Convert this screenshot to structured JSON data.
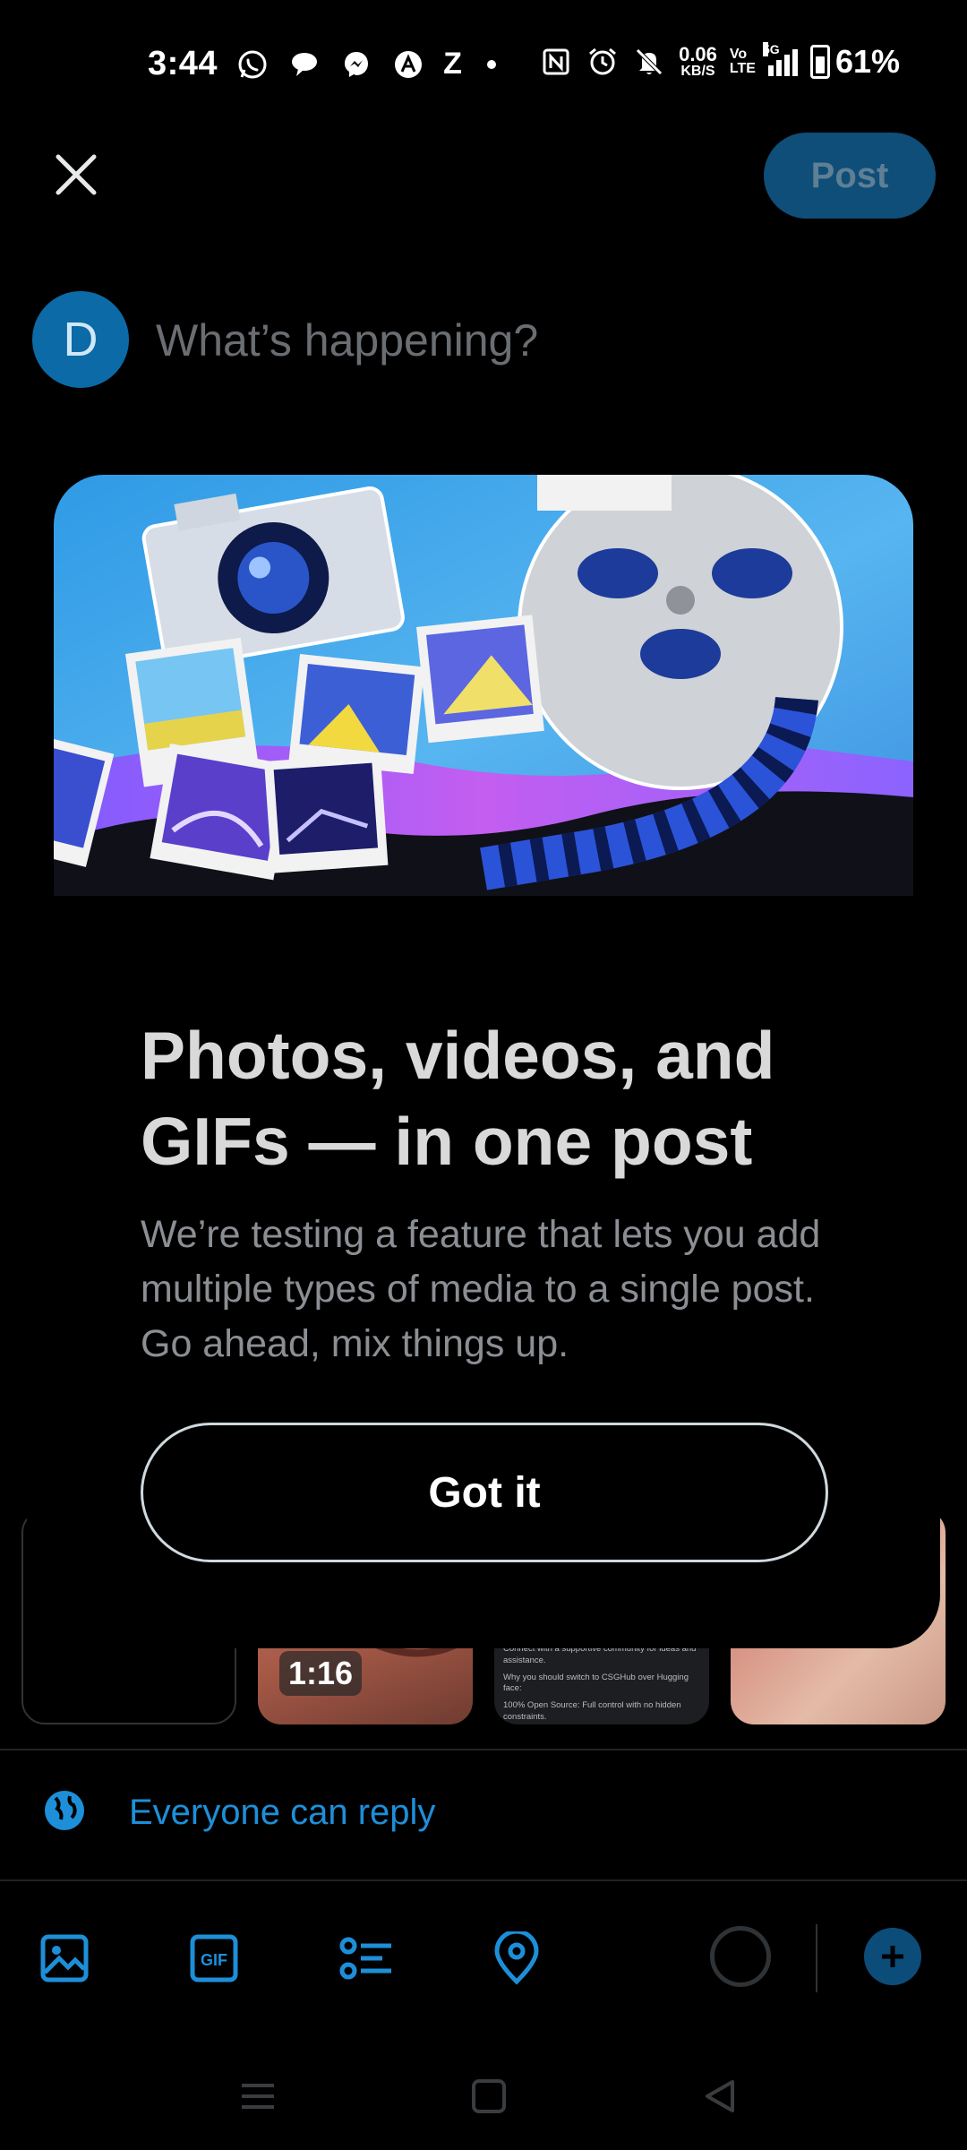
{
  "status_bar": {
    "time": "3:44",
    "icons": [
      "whatsapp-icon",
      "chat-bubble-icon",
      "messenger-icon",
      "app-a-icon",
      "z-app-icon",
      "dot-icon"
    ],
    "z_label": "Z",
    "right_icons": [
      "nfc-icon",
      "alarm-icon",
      "mute-icon"
    ],
    "net_speed_value": "0.06",
    "net_speed_unit": "KB/S",
    "volte_top": "Vo",
    "volte_bottom": "LTE",
    "network_type": "5G",
    "battery_percent": "61%"
  },
  "top_bar": {
    "close_icon": "close-icon",
    "post_label": "Post"
  },
  "compose": {
    "avatar_letter": "D",
    "placeholder": "What’s happening?"
  },
  "modal": {
    "title": "Photos, videos, and GIFs — in one post",
    "body": "We’re testing a feature that lets you add multiple types of media to a single post. Go ahead, mix things up.",
    "button_label": "Got it"
  },
  "media_strip": {
    "video_duration": "1:16",
    "doc_lines": [
      "Connect with a supportive community for ideas and assistance.",
      "Why you should switch to CSGHub over Hugging face:",
      "100% Open Source: Full control with no hidden constraints."
    ]
  },
  "reply_setting": {
    "icon": "globe-icon",
    "label": "Everyone can reply"
  },
  "toolbar": {
    "tools": [
      "image-icon",
      "gif-icon",
      "poll-icon",
      "location-icon"
    ],
    "gif_label": "GIF",
    "add_icon": "plus-icon"
  },
  "colors": {
    "accent": "#1d9bf0",
    "post_button_disabled": "#0f4e78",
    "background": "#000000"
  }
}
